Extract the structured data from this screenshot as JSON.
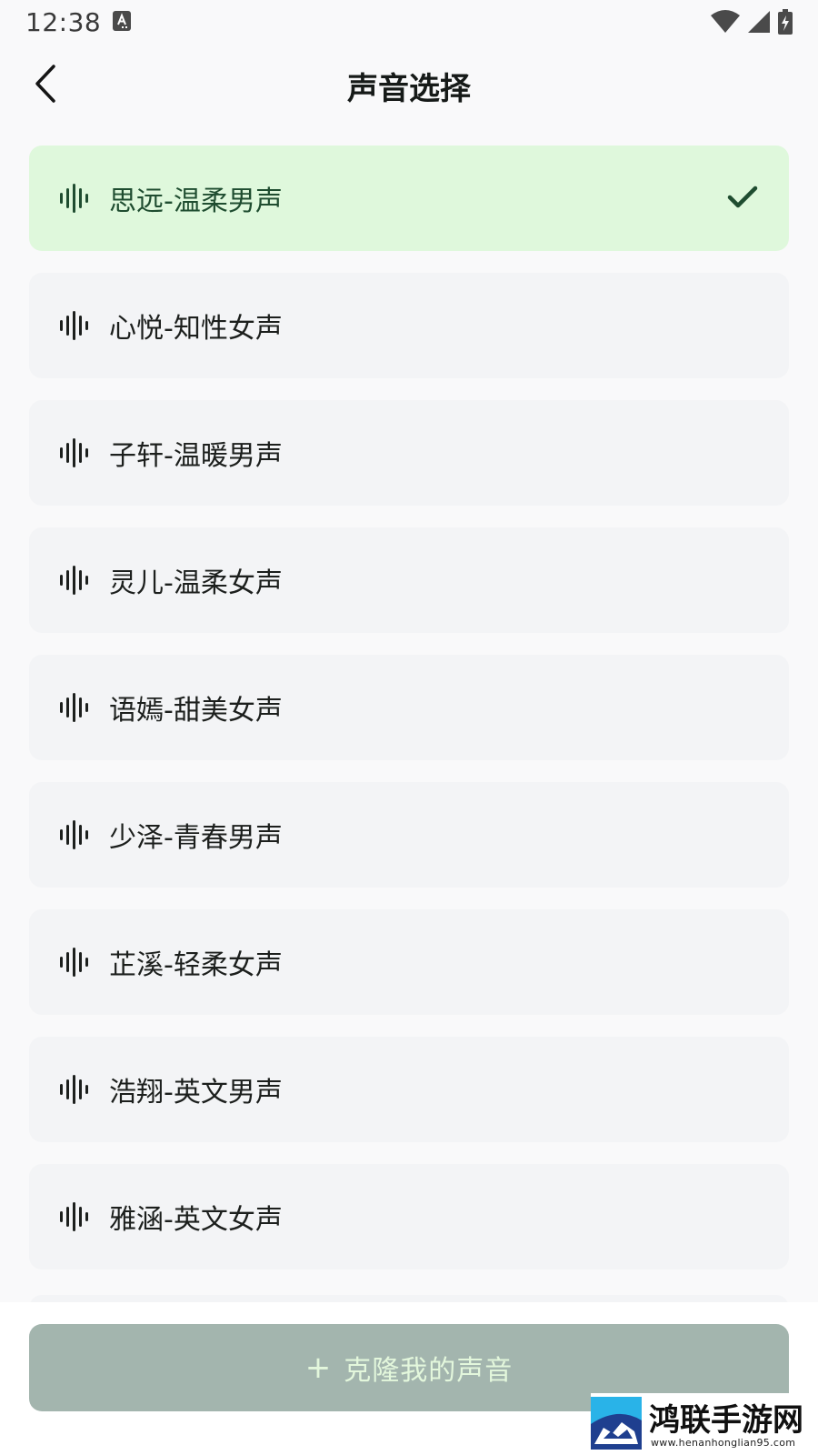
{
  "status_bar": {
    "time": "12:38",
    "icons": [
      "text-input-icon",
      "wifi-icon",
      "signal-icon",
      "battery-charging-icon"
    ]
  },
  "header": {
    "title": "声音选择",
    "back_icon": "chevron-left-icon"
  },
  "voices": {
    "items": [
      {
        "label": "思远-温柔男声",
        "selected": true
      },
      {
        "label": "心悦-知性女声",
        "selected": false
      },
      {
        "label": "子轩-温暖男声",
        "selected": false
      },
      {
        "label": "灵儿-温柔女声",
        "selected": false
      },
      {
        "label": "语嫣-甜美女声",
        "selected": false
      },
      {
        "label": "少泽-青春男声",
        "selected": false
      },
      {
        "label": "芷溪-轻柔女声",
        "selected": false
      },
      {
        "label": "浩翔-英文男声",
        "selected": false
      },
      {
        "label": "雅涵-英文女声",
        "selected": false
      }
    ],
    "item_icon": "audio-wave-icon",
    "selected_icon": "check-icon"
  },
  "clone_button": {
    "plus": "+",
    "label": "克隆我的声音"
  },
  "watermark": {
    "title": "鸿联手游网",
    "url": "www.henanhonglian95.com"
  },
  "colors": {
    "background": "#f9f9fa",
    "item_background": "#f3f4f6",
    "selected_background": "#dff8dc",
    "selected_accent": "#1f4d30",
    "button_background": "#a3b5ae",
    "button_text": "#e3f7dc"
  }
}
